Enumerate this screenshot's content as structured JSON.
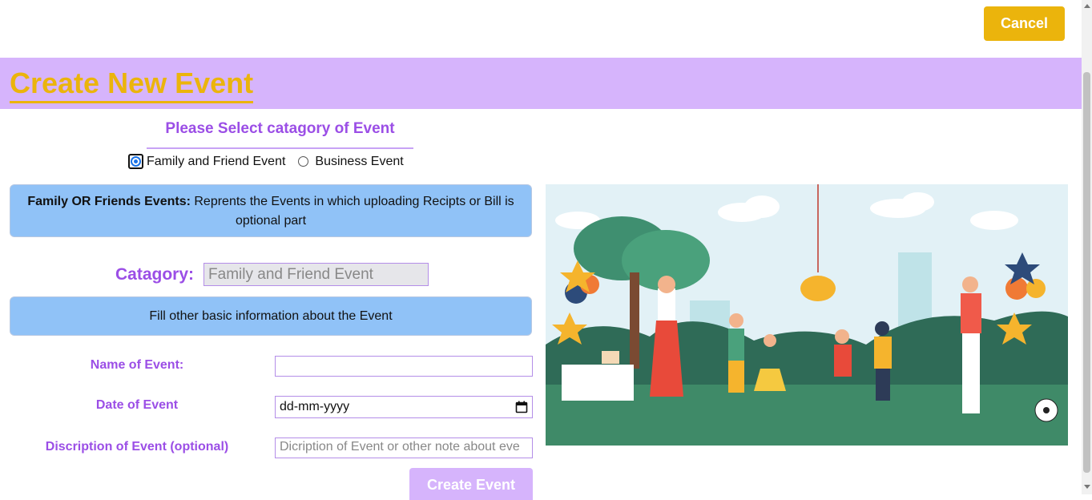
{
  "header": {
    "cancel_label": "Cancel",
    "title": "Create New Event"
  },
  "category_select": {
    "heading": "Please Select catagory of Event",
    "options": [
      {
        "label": "Family and Friend Event",
        "selected": true
      },
      {
        "label": "Business Event",
        "selected": false
      }
    ]
  },
  "info_family": {
    "bold": "Family OR Friends Events:",
    "text": " Reprents the Events in which uploading Recipts or Bill is optional part"
  },
  "category_field": {
    "label": "Catagory:",
    "value": "Family and Friend Event"
  },
  "info_basic": {
    "text": "Fill other basic information about the Event"
  },
  "form": {
    "name_label": "Name of Event:",
    "name_value": "",
    "date_label": "Date of Event",
    "date_placeholder": "dd-mm-yyyy",
    "description_label": "Discription of Event (optional)",
    "description_placeholder": "Dicription of Event or other note about eve",
    "submit_label": "Create Event"
  },
  "colors": {
    "accent_yellow": "#ebb40c",
    "banner_purple": "#d6b4fc",
    "label_purple": "#9b4ee6",
    "info_blue": "#90c2f7"
  },
  "icons": {
    "calendar": "calendar-icon",
    "illustration": "party-illustration"
  }
}
